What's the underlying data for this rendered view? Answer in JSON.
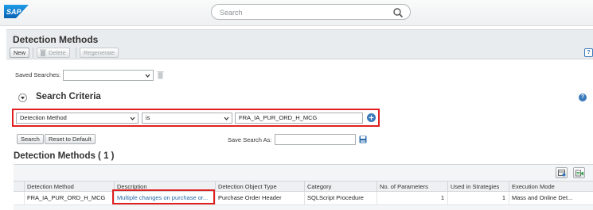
{
  "shell": {
    "logo": "SAP",
    "search_placeholder": "Search"
  },
  "page": {
    "title": "Detection Methods",
    "toolbar": {
      "new_label": "New",
      "delete_label": "Delete",
      "regenerate_label": "Regenerate"
    }
  },
  "saved_searches": {
    "label": "Saved Searches:",
    "value": ""
  },
  "criteria": {
    "title": "Search Criteria",
    "field": "Detection Method",
    "operator": "is",
    "value": "FRA_IA_PUR_ORD_H_MCG",
    "search_label": "Search",
    "reset_label": "Reset to Default",
    "save_as_label": "Save Search As:",
    "save_as_value": ""
  },
  "results": {
    "title": "Detection Methods ( 1 )",
    "columns": [
      "Detection Method",
      "Description",
      "Detection Object Type",
      "Category",
      "No. of Parameters",
      "Used in Strategies",
      "Execution Mode"
    ],
    "rows": [
      {
        "detection_method": "FRA_IA_PUR_ORD_H_MCG",
        "description": "Multiple changes on purchase or...",
        "object_type": "Purchase Order Header",
        "category": "SQLScript Procedure",
        "parameters": "1",
        "strategies": "1",
        "execution_mode": "Mass and Online Det..."
      }
    ]
  },
  "colors": {
    "accent": "#3a79ba",
    "highlight": "#e02020",
    "link": "#2467a8"
  }
}
